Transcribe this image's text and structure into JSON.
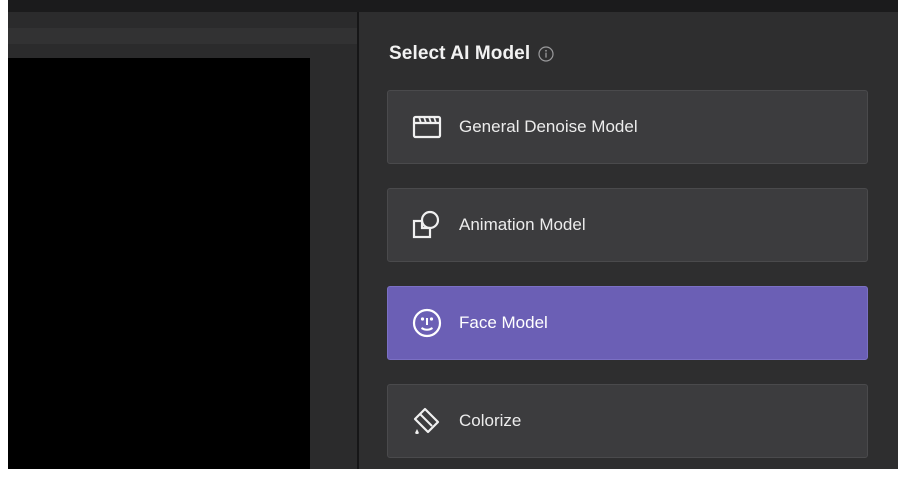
{
  "panel": {
    "title": "Select AI Model",
    "info_icon": "info-icon"
  },
  "models": [
    {
      "label": "General Denoise Model",
      "icon": "clapperboard-icon",
      "selected": false
    },
    {
      "label": "Animation Model",
      "icon": "shapes-icon",
      "selected": false
    },
    {
      "label": "Face Model",
      "icon": "face-icon",
      "selected": true
    },
    {
      "label": "Colorize",
      "icon": "paint-bucket-icon",
      "selected": false
    }
  ],
  "colors": {
    "panel_bg": "#2e2e2f",
    "button_bg": "#3c3c3e",
    "selected_bg": "#6b5fb5",
    "preview_bg": "#000000"
  }
}
